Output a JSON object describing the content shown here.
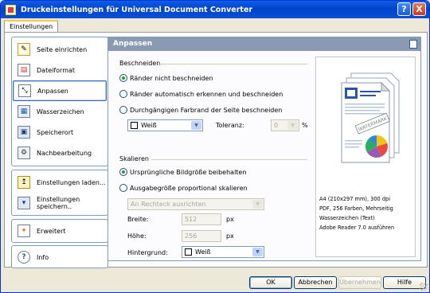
{
  "window": {
    "title": "Druckeinstellungen für Universal Document Converter"
  },
  "title_buttons": {
    "help": "?",
    "close": "X"
  },
  "tab": {
    "label": "Einstellungen"
  },
  "sidebar": {
    "main_items": [
      {
        "label": "Seite einrichten",
        "icon": "page-setup-icon"
      },
      {
        "label": "Dateiformat",
        "icon": "file-format-icon"
      },
      {
        "label": "Anpassen",
        "icon": "adjust-icon"
      },
      {
        "label": "Wasserzeichen",
        "icon": "watermark-icon"
      },
      {
        "label": "Speicherort",
        "icon": "save-location-icon"
      },
      {
        "label": "Nachbearbeitung",
        "icon": "post-processing-icon"
      }
    ],
    "settings_items": [
      {
        "label": "Einstellungen laden...",
        "icon": "load-settings-icon"
      },
      {
        "label": "Einstellungen speichern..",
        "icon": "save-settings-icon"
      }
    ],
    "advanced": {
      "label": "Erweitert",
      "icon": "advanced-icon"
    },
    "info": {
      "label": "Info",
      "icon": "info-icon"
    }
  },
  "panel": {
    "title": "Anpassen",
    "crop": {
      "title": "Beschneiden",
      "options": [
        "Ränder nicht beschneiden",
        "Ränder automatisch erkennen und beschneiden",
        "Durchgängigen Farbrand der Seite beschneiden"
      ],
      "selected_index": 0,
      "color_value": "Weiß",
      "tolerance_label": "Toleranz:",
      "tolerance_value": "0",
      "tolerance_unit": "%"
    },
    "scale": {
      "title": "Skalieren",
      "options": [
        "Ursprüngliche Bildgröße beibehalten",
        "Ausgabegröße proportional skalieren"
      ],
      "selected_index": 0,
      "fit_value": "An Rechteck ausrichten",
      "width_label": "Breite:",
      "width_value": "512",
      "width_unit": "px",
      "height_label": "Höhe:",
      "height_value": "256",
      "height_unit": "px",
      "background_label": "Hintergrund:",
      "background_value": "Weiß"
    },
    "preview": {
      "watermark": "WATERMARK",
      "lines": [
        "A4 (210x297 mm), 300 dpi",
        "PDF, 256 Farben, Mehrseitig",
        "Wasserzeichen (Text)",
        "Adobe Reader 7.0 ausführen"
      ]
    }
  },
  "footer": {
    "ok": "OK",
    "cancel": "Abbrechen",
    "apply": "Übernehmen",
    "help": "Hilfe"
  }
}
